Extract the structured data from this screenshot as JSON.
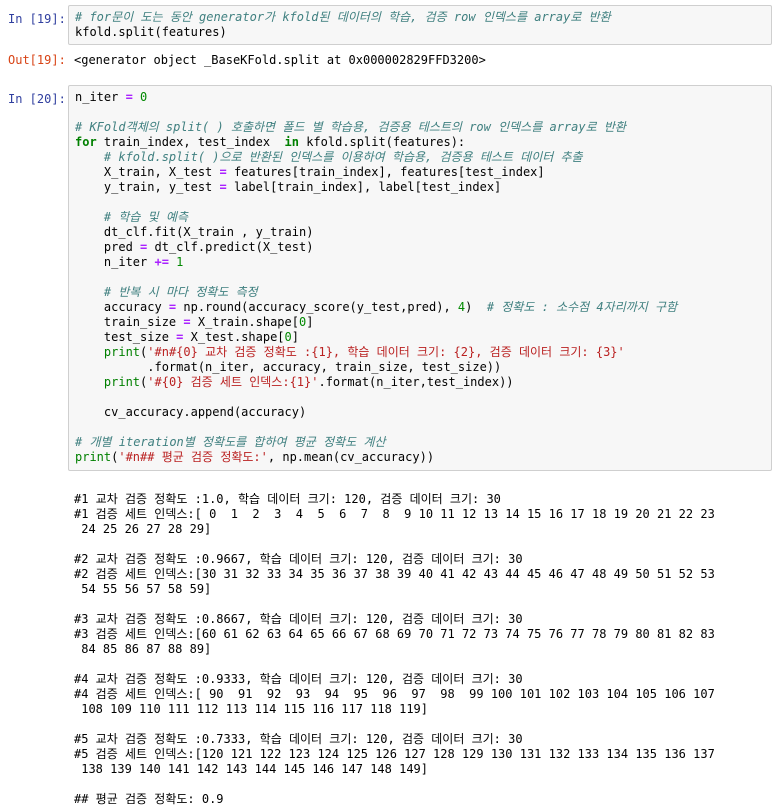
{
  "cell19": {
    "in_prompt": "In [19]:",
    "out_prompt": "Out[19]:",
    "code": [
      {
        "parts": [
          {
            "t": "# for문이 도는 동안 generator가 kfold된 데이터의 학습, 검증 row 인덱스를 array로 반환",
            "cls": "c"
          }
        ]
      },
      {
        "parts": [
          {
            "t": "kfold.split(features)",
            "cls": ""
          }
        ]
      }
    ],
    "output": "<generator object _BaseKFold.split at 0x000002829FFD3200>"
  },
  "cell20": {
    "in_prompt": "In [20]:",
    "code": [
      {
        "parts": [
          {
            "t": "n_iter ",
            "cls": ""
          },
          {
            "t": "=",
            "cls": "o"
          },
          {
            "t": " 0",
            "cls": "n"
          }
        ]
      },
      {
        "parts": [
          {
            "t": "",
            "cls": ""
          }
        ]
      },
      {
        "parts": [
          {
            "t": "# KFold객체의 split( ) 호출하면 폴드 별 학습용, 검증용 테스트의 row 인덱스를 array로 반환",
            "cls": "c"
          }
        ]
      },
      {
        "parts": [
          {
            "t": "for",
            "cls": "k"
          },
          {
            "t": " train_index, test_index  ",
            "cls": ""
          },
          {
            "t": "in",
            "cls": "k"
          },
          {
            "t": " kfold.split(features):",
            "cls": ""
          }
        ]
      },
      {
        "parts": [
          {
            "t": "    # kfold.split( )으로 반환된 인덱스를 이용하여 학습용, 검증용 테스트 데이터 추출",
            "cls": "c"
          }
        ]
      },
      {
        "parts": [
          {
            "t": "    X_train, X_test ",
            "cls": ""
          },
          {
            "t": "=",
            "cls": "o"
          },
          {
            "t": " features[train_index], features[test_index]",
            "cls": ""
          }
        ]
      },
      {
        "parts": [
          {
            "t": "    y_train, y_test ",
            "cls": ""
          },
          {
            "t": "=",
            "cls": "o"
          },
          {
            "t": " label[train_index], label[test_index]",
            "cls": ""
          }
        ]
      },
      {
        "parts": [
          {
            "t": "",
            "cls": ""
          }
        ]
      },
      {
        "parts": [
          {
            "t": "    # 학습 및 예측",
            "cls": "c"
          }
        ]
      },
      {
        "parts": [
          {
            "t": "    dt_clf.fit(X_train , y_train)",
            "cls": ""
          }
        ]
      },
      {
        "parts": [
          {
            "t": "    pred ",
            "cls": ""
          },
          {
            "t": "=",
            "cls": "o"
          },
          {
            "t": " dt_clf.predict(X_test)",
            "cls": ""
          }
        ]
      },
      {
        "parts": [
          {
            "t": "    n_iter ",
            "cls": ""
          },
          {
            "t": "+=",
            "cls": "o"
          },
          {
            "t": " 1",
            "cls": "n"
          }
        ]
      },
      {
        "parts": [
          {
            "t": "",
            "cls": ""
          }
        ]
      },
      {
        "parts": [
          {
            "t": "    # 반복 시 마다 정확도 측정",
            "cls": "c"
          }
        ]
      },
      {
        "parts": [
          {
            "t": "    accuracy ",
            "cls": ""
          },
          {
            "t": "=",
            "cls": "o"
          },
          {
            "t": " np.round(accuracy_score(y_test,pred), ",
            "cls": ""
          },
          {
            "t": "4",
            "cls": "n"
          },
          {
            "t": ")  ",
            "cls": ""
          },
          {
            "t": "# 정확도 : 소수점 4자리까지 구함",
            "cls": "c"
          }
        ]
      },
      {
        "parts": [
          {
            "t": "    train_size ",
            "cls": ""
          },
          {
            "t": "=",
            "cls": "o"
          },
          {
            "t": " X_train.shape[",
            "cls": ""
          },
          {
            "t": "0",
            "cls": "n"
          },
          {
            "t": "]",
            "cls": ""
          }
        ]
      },
      {
        "parts": [
          {
            "t": "    test_size ",
            "cls": ""
          },
          {
            "t": "=",
            "cls": "o"
          },
          {
            "t": " X_test.shape[",
            "cls": ""
          },
          {
            "t": "0",
            "cls": "n"
          },
          {
            "t": "]",
            "cls": ""
          }
        ]
      },
      {
        "parts": [
          {
            "t": "    print",
            "cls": "b"
          },
          {
            "t": "(",
            "cls": ""
          },
          {
            "t": "'#n#{0} 교차 검증 정확도 :{1}, 학습 데이터 크기: {2}, 검증 데이터 크기: {3}'",
            "cls": "s"
          }
        ]
      },
      {
        "parts": [
          {
            "t": "          .format(n_iter, accuracy, train_size, test_size))",
            "cls": ""
          }
        ]
      },
      {
        "parts": [
          {
            "t": "    print",
            "cls": "b"
          },
          {
            "t": "(",
            "cls": ""
          },
          {
            "t": "'#{0} 검증 세트 인덱스:{1}'",
            "cls": "s"
          },
          {
            "t": ".format(n_iter,test_index))",
            "cls": ""
          }
        ]
      },
      {
        "parts": [
          {
            "t": "",
            "cls": ""
          }
        ]
      },
      {
        "parts": [
          {
            "t": "    cv_accuracy.append(accuracy)",
            "cls": ""
          }
        ]
      },
      {
        "parts": [
          {
            "t": "",
            "cls": ""
          }
        ]
      },
      {
        "parts": [
          {
            "t": "# 개별 iteration별 정확도를 합하여 평균 정확도 계산",
            "cls": "c"
          }
        ]
      },
      {
        "parts": [
          {
            "t": "print",
            "cls": "b"
          },
          {
            "t": "(",
            "cls": ""
          },
          {
            "t": "'#n## 평균 검증 정확도:'",
            "cls": "s"
          },
          {
            "t": ", np.mean(cv_accuracy))",
            "cls": ""
          }
        ]
      }
    ],
    "stdout": [
      "#1 교차 검증 정확도 :1.0, 학습 데이터 크기: 120, 검증 데이터 크기: 30",
      "#1 검증 세트 인덱스:[ 0  1  2  3  4  5  6  7  8  9 10 11 12 13 14 15 16 17 18 19 20 21 22 23",
      " 24 25 26 27 28 29]",
      "",
      "#2 교차 검증 정확도 :0.9667, 학습 데이터 크기: 120, 검증 데이터 크기: 30",
      "#2 검증 세트 인덱스:[30 31 32 33 34 35 36 37 38 39 40 41 42 43 44 45 46 47 48 49 50 51 52 53",
      " 54 55 56 57 58 59]",
      "",
      "#3 교차 검증 정확도 :0.8667, 학습 데이터 크기: 120, 검증 데이터 크기: 30",
      "#3 검증 세트 인덱스:[60 61 62 63 64 65 66 67 68 69 70 71 72 73 74 75 76 77 78 79 80 81 82 83",
      " 84 85 86 87 88 89]",
      "",
      "#4 교차 검증 정확도 :0.9333, 학습 데이터 크기: 120, 검증 데이터 크기: 30",
      "#4 검증 세트 인덱스:[ 90  91  92  93  94  95  96  97  98  99 100 101 102 103 104 105 106 107",
      " 108 109 110 111 112 113 114 115 116 117 118 119]",
      "",
      "#5 교차 검증 정확도 :0.7333, 학습 데이터 크기: 120, 검증 데이터 크기: 30",
      "#5 검증 세트 인덱스:[120 121 122 123 124 125 126 127 128 129 130 131 132 133 134 135 136 137",
      " 138 139 140 141 142 143 144 145 146 147 148 149]",
      "",
      "## 평균 검증 정확도: 0.9"
    ]
  }
}
